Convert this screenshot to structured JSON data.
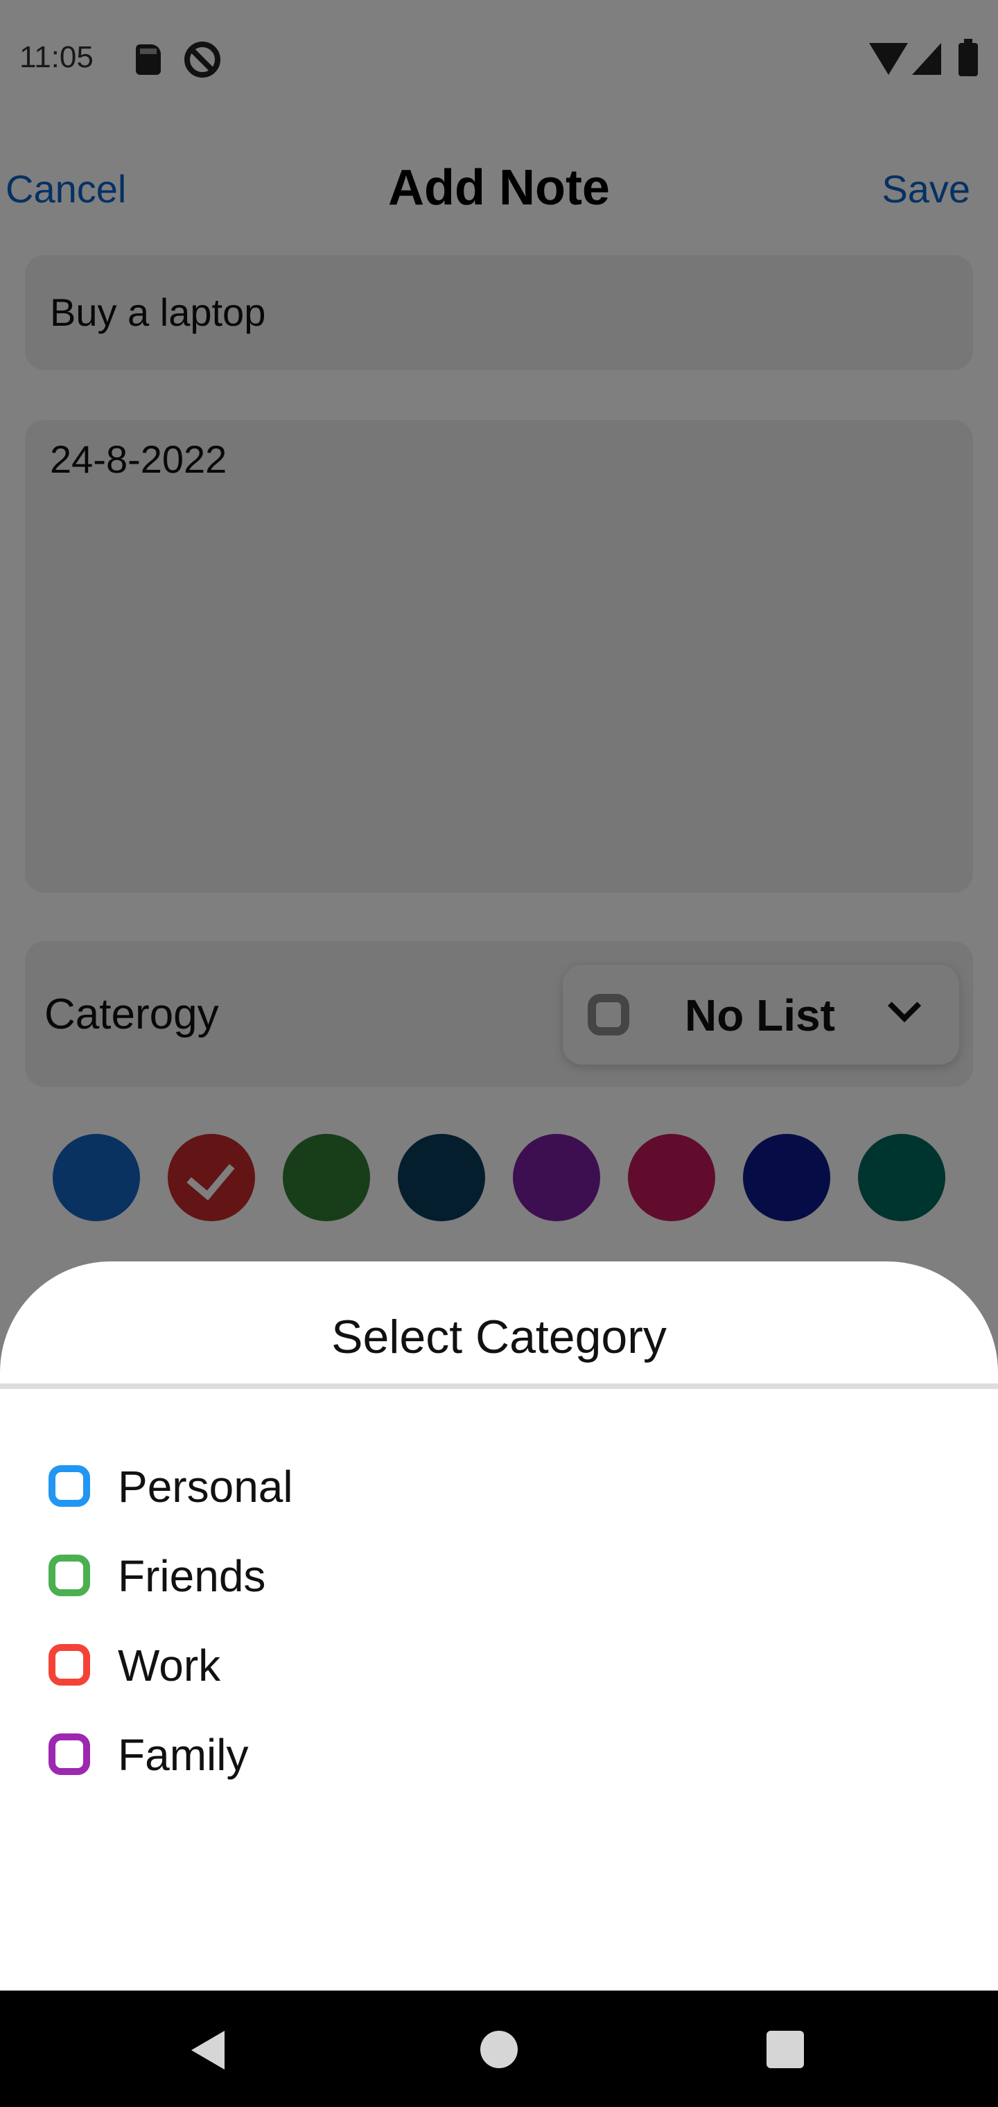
{
  "status_bar": {
    "time": "11:05"
  },
  "header": {
    "cancel_label": "Cancel",
    "title": "Add Note",
    "save_label": "Save"
  },
  "note": {
    "title_value": "Buy a laptop",
    "body_value": "24-8-2022"
  },
  "category": {
    "label": "Caterogy",
    "selected": "No List"
  },
  "colors": {
    "swatches": [
      "#1565c0",
      "#c62828",
      "#2e7d32",
      "#0b3c5d",
      "#7b1fa2",
      "#c2185b",
      "#0d1b8c",
      "#00695c"
    ],
    "selected_index": 1
  },
  "sheet": {
    "title": "Select Category",
    "options": [
      {
        "label": "Personal",
        "color": "#2196f3"
      },
      {
        "label": "Friends",
        "color": "#4caf50"
      },
      {
        "label": "Work",
        "color": "#f44336"
      },
      {
        "label": "Family",
        "color": "#9c27b0"
      }
    ]
  },
  "nav": {
    "back_icon": "back-triangle-icon",
    "home_icon": "home-circle-icon",
    "recents_icon": "recents-square-icon"
  }
}
